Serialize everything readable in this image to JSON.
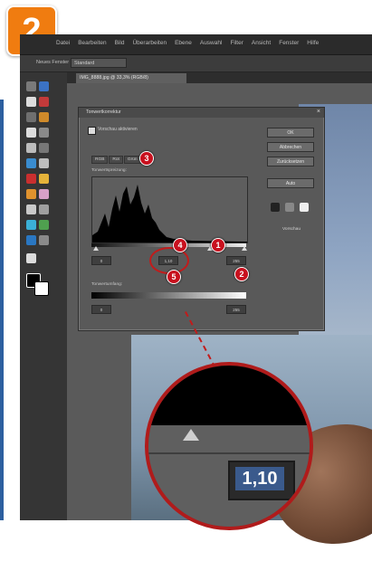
{
  "step": "2",
  "menu": {
    "items": [
      "Datei",
      "Bearbeiten",
      "Bild",
      "Überarbeiten",
      "Ebene",
      "Auswahl",
      "Filter",
      "Ansicht",
      "Fenster",
      "Hilfe"
    ]
  },
  "options_bar": {
    "label": "Neues Fenster",
    "dropdown": "Standard"
  },
  "document_tab": "IMG_8888.jpg @ 33,3% (RGB/8)",
  "dialog": {
    "title": "Tonwertkorrektur",
    "checkbox_label": "Vorschau aktivieren",
    "buttons": [
      "OK",
      "Abbrechen",
      "Zurücksetzen",
      "Auto"
    ],
    "channel_tabs": [
      "RGB",
      "Rot",
      "Grün"
    ],
    "input_label": "Tonwertspreizung:",
    "input_values": [
      "0",
      "1,10",
      "255"
    ],
    "output_label": "Tonwertumfang:",
    "output_values": [
      "0",
      "255"
    ],
    "preview_label": "Vorschau"
  },
  "callouts": [
    "1",
    "2",
    "3",
    "4",
    "5"
  ],
  "zoom_value": "1,10",
  "colors": {
    "badge": "#f07c10",
    "callout": "#c8101e",
    "zoom_border": "#b01b1b",
    "highlight": "#3a5a8c"
  }
}
